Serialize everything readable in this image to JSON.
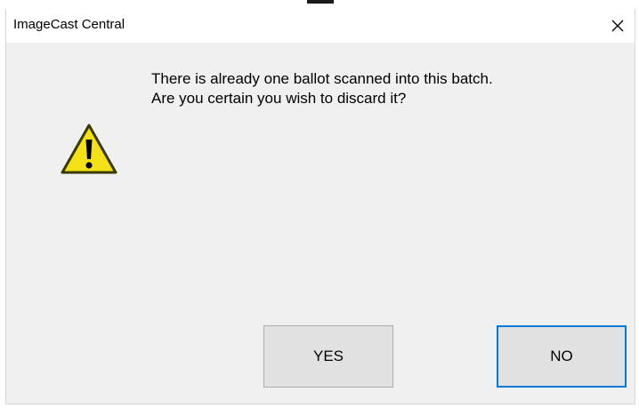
{
  "window": {
    "title": "ImageCast Central",
    "close_icon": "close-icon"
  },
  "dialog": {
    "icon": "warning-icon",
    "icon_colors": {
      "fill": "#f5e11a",
      "outline": "#3a3a00"
    },
    "message_line_1": "There is already one ballot scanned into this batch.",
    "message_line_2": "Are you certain you wish to discard it?"
  },
  "buttons": {
    "yes_label": "YES",
    "no_label": "NO",
    "default_button": "NO",
    "focus_color": "#0078d7"
  }
}
